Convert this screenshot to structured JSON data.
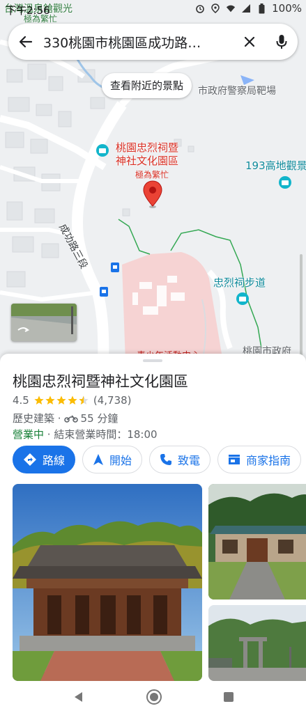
{
  "status_bar": {
    "time": "下午2:56",
    "battery": "100%"
  },
  "search": {
    "query": "330桃園市桃園區成功路…"
  },
  "map": {
    "nearby_chip": "查看附近的景點",
    "labels": {
      "top_left_1": "台灣溫泉鎗觀光",
      "top_left_2": "極為繁忙",
      "police_range": "市政府警察局靶場",
      "place_line1": "桃園忠烈祠暨",
      "place_line2": "神社文化園區",
      "place_busy": "極為繁忙",
      "highland": "193高地觀景",
      "road": "成功路三段",
      "trail": "忠烈祠步道",
      "city_gov": "桃園市政府",
      "bottom_red": "青少年活動中心"
    }
  },
  "place": {
    "title": "桃園忠烈祠暨神社文化園區",
    "rating": "4.5",
    "review_count": "(4,738)",
    "category": "歷史建築 ·",
    "travel_time": "55 分鐘",
    "open_status": "營業中",
    "hours": " · 結束營業時間：18:00"
  },
  "actions": [
    {
      "label": "路線",
      "icon": "directions-icon"
    },
    {
      "label": "開始",
      "icon": "navigation-icon"
    },
    {
      "label": "致電",
      "icon": "phone-icon"
    },
    {
      "label": "商家指南",
      "icon": "storefront-icon"
    }
  ],
  "colors": {
    "accent": "#1a73e8",
    "open": "#188038",
    "pin": "#ea4335",
    "star": "#fbbc04"
  }
}
